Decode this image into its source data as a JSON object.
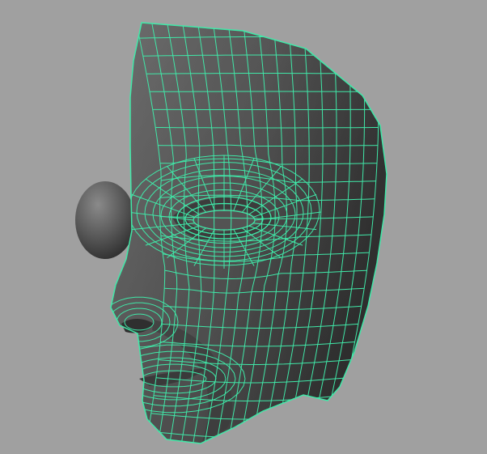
{
  "viewport": {
    "background_color": "#a0a0a0",
    "wireframe_color": "#40e8a8",
    "surface_dark": "#474747",
    "surface_mid": "#626262",
    "surface_light": "#7a7a7a"
  },
  "objects": [
    {
      "name": "face-mesh",
      "selected": true
    },
    {
      "name": "eye-sphere",
      "selected": false
    }
  ]
}
